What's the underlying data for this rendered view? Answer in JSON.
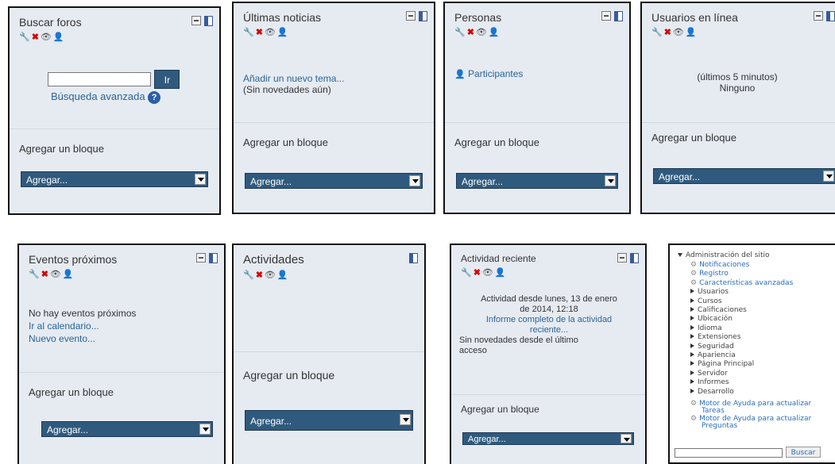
{
  "icons": {
    "wrench": "🔧",
    "delete": "✖",
    "eye": "👁",
    "roles": "👤"
  },
  "add_block": {
    "title": "Agregar un bloque",
    "select_value": "Agregar..."
  },
  "buscar_foros": {
    "title": "Buscar foros",
    "button": "Ir",
    "advanced": "Búsqueda avanzada",
    "help": "?"
  },
  "ultimas_noticias": {
    "title": "Últimas noticias",
    "link": "Añadir un nuevo tema...",
    "text": "(Sin novedades aún)"
  },
  "personas": {
    "title": "Personas",
    "link": "Participantes"
  },
  "usuarios_en_linea": {
    "title": "Usuarios en línea",
    "line1": "(últimos 5 minutos)",
    "line2": "Ninguno"
  },
  "eventos_proximos": {
    "title": "Eventos próximos",
    "text": "No hay eventos próximos",
    "link1": "Ir al calendario...",
    "link2": "Nuevo evento..."
  },
  "actividades": {
    "title": "Actividades"
  },
  "actividad_reciente": {
    "title": "Actividad reciente",
    "line1": "Actividad desde lunes, 13 de enero",
    "line2": "de 2014, 12:18",
    "link1": "Informe completo de la actividad",
    "link2": "reciente...",
    "line3": "Sin novedades desde el último",
    "line4": "acceso"
  },
  "admin": {
    "header": "Administración del sitio",
    "items": [
      {
        "label": "Notificaciones",
        "type": "gear"
      },
      {
        "label": "Registro",
        "type": "gear"
      },
      {
        "label": "Características avanzadas",
        "type": "gear"
      },
      {
        "label": "Usuarios",
        "type": "folder"
      },
      {
        "label": "Cursos",
        "type": "folder"
      },
      {
        "label": "Calificaciones",
        "type": "folder"
      },
      {
        "label": "Ubicación",
        "type": "folder"
      },
      {
        "label": "Idioma",
        "type": "folder"
      },
      {
        "label": "Extensiones",
        "type": "folder"
      },
      {
        "label": "Seguridad",
        "type": "folder"
      },
      {
        "label": "Apariencia",
        "type": "folder"
      },
      {
        "label": "Página Principal",
        "type": "folder"
      },
      {
        "label": "Servidor",
        "type": "folder"
      },
      {
        "label": "Informes",
        "type": "folder"
      },
      {
        "label": "Desarrollo",
        "type": "folder"
      }
    ],
    "motor1_a": "Motor de Ayuda para actualizar",
    "motor1_b": "Tareas",
    "motor2_a": "Motor de Ayuda para actualizar",
    "motor2_b": "Preguntas",
    "search_button": "Buscar"
  }
}
